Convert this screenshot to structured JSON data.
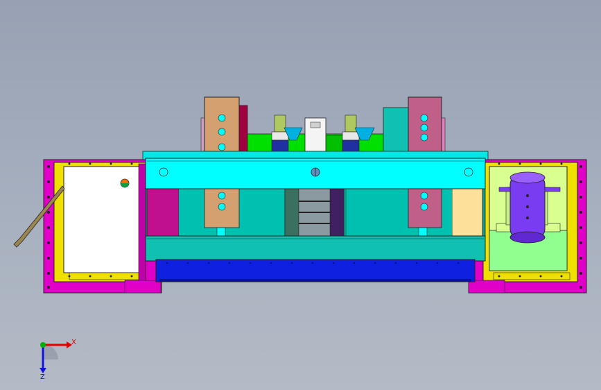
{
  "view": {
    "axis_x_label": "X",
    "axis_z_label": "Z"
  },
  "colors": {
    "background_top": "#97a1b3",
    "background_bottom": "#b4bbc6",
    "frame_magenta": "#e000c8",
    "frame_yellow": "#f0e000",
    "beam_cyan": "#00ffff",
    "beam_teal": "#10c0b0",
    "tray_blue": "#1020e0",
    "panel_white": "#ffffff",
    "slider_tan": "#d4a070",
    "slider_mauve": "#c06088",
    "green_plate": "#00e000",
    "tank_purple": "#7a3cf0",
    "cabinet_green": "#d8ff90",
    "light_green": "#90ff90",
    "maroon": "#a00040",
    "peach": "#fde09a",
    "axis_red": "#e00000",
    "axis_blue": "#1010e0",
    "axis_green": "#00b000"
  },
  "icons": {
    "view_triad": "coordinate-triad-icon",
    "indicator_lamp": "indicator-lamp-icon"
  }
}
